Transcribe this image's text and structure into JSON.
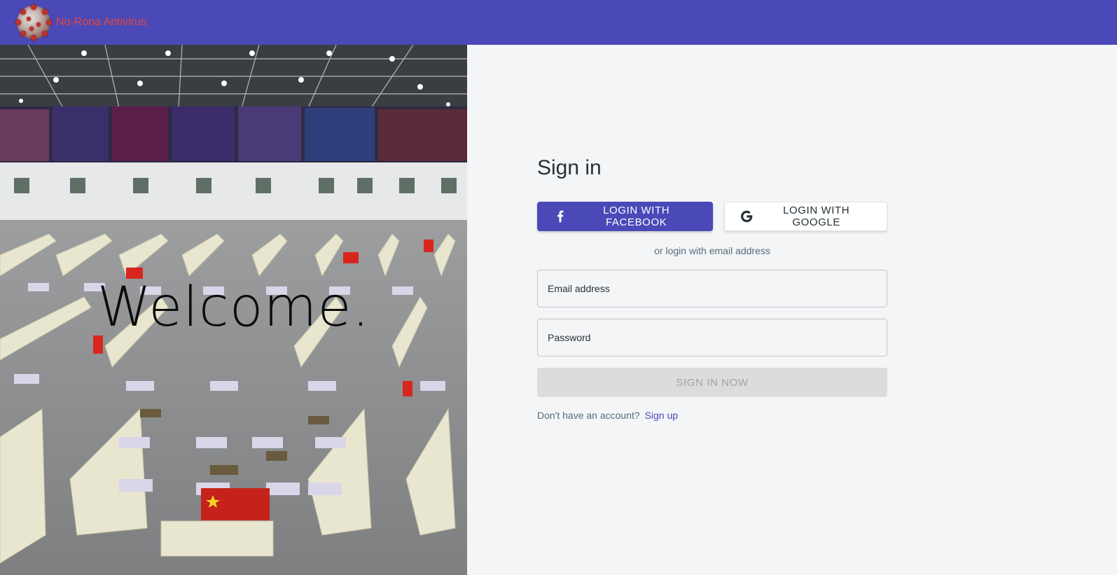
{
  "app": {
    "brand_name": "No-Rona Antivirus",
    "logo_icon": "virus-icon"
  },
  "hero": {
    "welcome_text": "Welcome."
  },
  "signin": {
    "title": "Sign in",
    "facebook_label": "LOGIN WITH FACEBOOK",
    "google_label": "LOGIN WITH GOOGLE",
    "or_text": "or login with email address",
    "email_placeholder": "Email address",
    "email_value": "",
    "password_placeholder": "Password",
    "password_value": "",
    "submit_label": "SIGN IN NOW",
    "no_account_text": "Don't have an account?",
    "signup_link": "Sign up"
  },
  "colors": {
    "primary": "#4a49b7",
    "brand_text": "#e4463d",
    "background": "#f4f5f7",
    "disabled_button": "#dcdcdc"
  }
}
